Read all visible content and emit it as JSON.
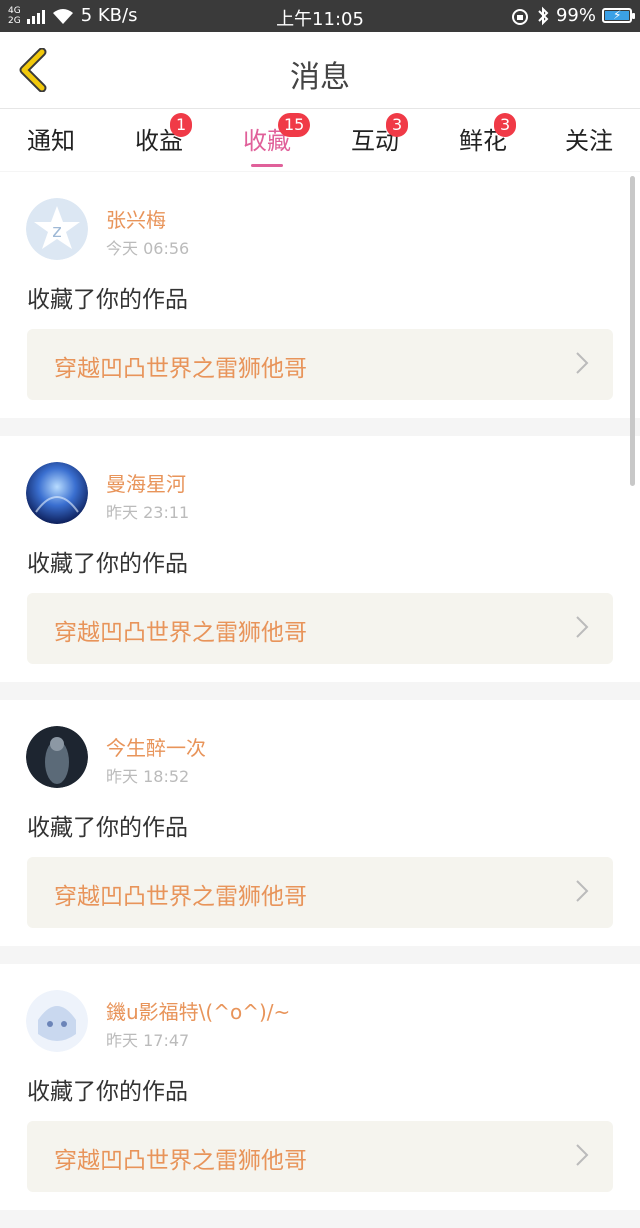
{
  "status_bar": {
    "net": "4G\n2G",
    "speed": "5 KB/s",
    "time": "上午11:05",
    "battery_pct": "99%",
    "battery_level": 0.99,
    "icons": [
      "signal-icon",
      "wifi-icon",
      "alarm-icon",
      "bluetooth-icon",
      "battery-icon"
    ]
  },
  "header": {
    "title": "消息",
    "back_icon": "chevron-left-icon",
    "accent": "#f2c90c"
  },
  "tabs": [
    {
      "label": "通知",
      "badge": ""
    },
    {
      "label": "收益",
      "badge": "1"
    },
    {
      "label": "收藏",
      "badge": "15",
      "active": true
    },
    {
      "label": "互动",
      "badge": "3"
    },
    {
      "label": "鲜花",
      "badge": "3"
    },
    {
      "label": "关注",
      "badge": ""
    }
  ],
  "colors": {
    "active_tab": "#e0609a",
    "badge": "#f03a47",
    "name": "#e8945a"
  },
  "items": [
    {
      "name": "张兴梅",
      "time": "今天 06:56",
      "action": "收藏了你的作品",
      "work": "穿越凹凸世界之雷狮他哥"
    },
    {
      "name": "曼海星河",
      "time": "昨天 23:11",
      "action": "收藏了你的作品",
      "work": "穿越凹凸世界之雷狮他哥"
    },
    {
      "name": "今生醉一次",
      "time": "昨天 18:52",
      "action": "收藏了你的作品",
      "work": "穿越凹凸世界之雷狮他哥"
    },
    {
      "name": "鐖u影福特\\(^o^)/~",
      "time": "昨天 17:47",
      "action": "收藏了你的作品",
      "work": "穿越凹凸世界之雷狮他哥"
    }
  ]
}
